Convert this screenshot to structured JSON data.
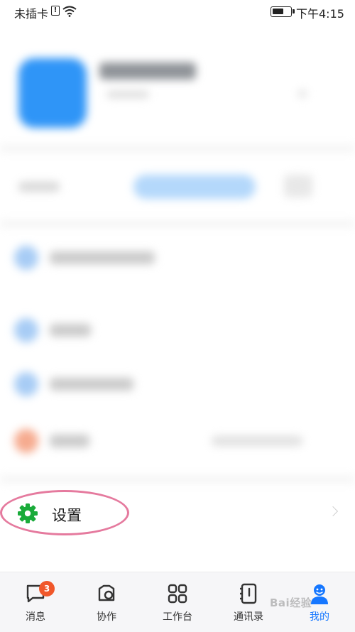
{
  "status_bar": {
    "carrier": "未插卡",
    "sim_icon": "!",
    "time": "下午4:15"
  },
  "settings": {
    "label": "设置",
    "icon": "gear-icon",
    "icon_color": "#1aab3a",
    "highlight_color": "#e57a9e"
  },
  "tabs": [
    {
      "label": "消息",
      "icon": "chat-bubble-icon",
      "badge": "3"
    },
    {
      "label": "协作",
      "icon": "collaboration-icon"
    },
    {
      "label": "工作台",
      "icon": "grid-icon"
    },
    {
      "label": "通讯录",
      "icon": "contacts-book-icon"
    },
    {
      "label": "我的",
      "icon": "profile-icon",
      "active": true
    }
  ],
  "accent_color": "#1677ff",
  "badge_color": "#f0572a",
  "watermark": "Bai经验"
}
